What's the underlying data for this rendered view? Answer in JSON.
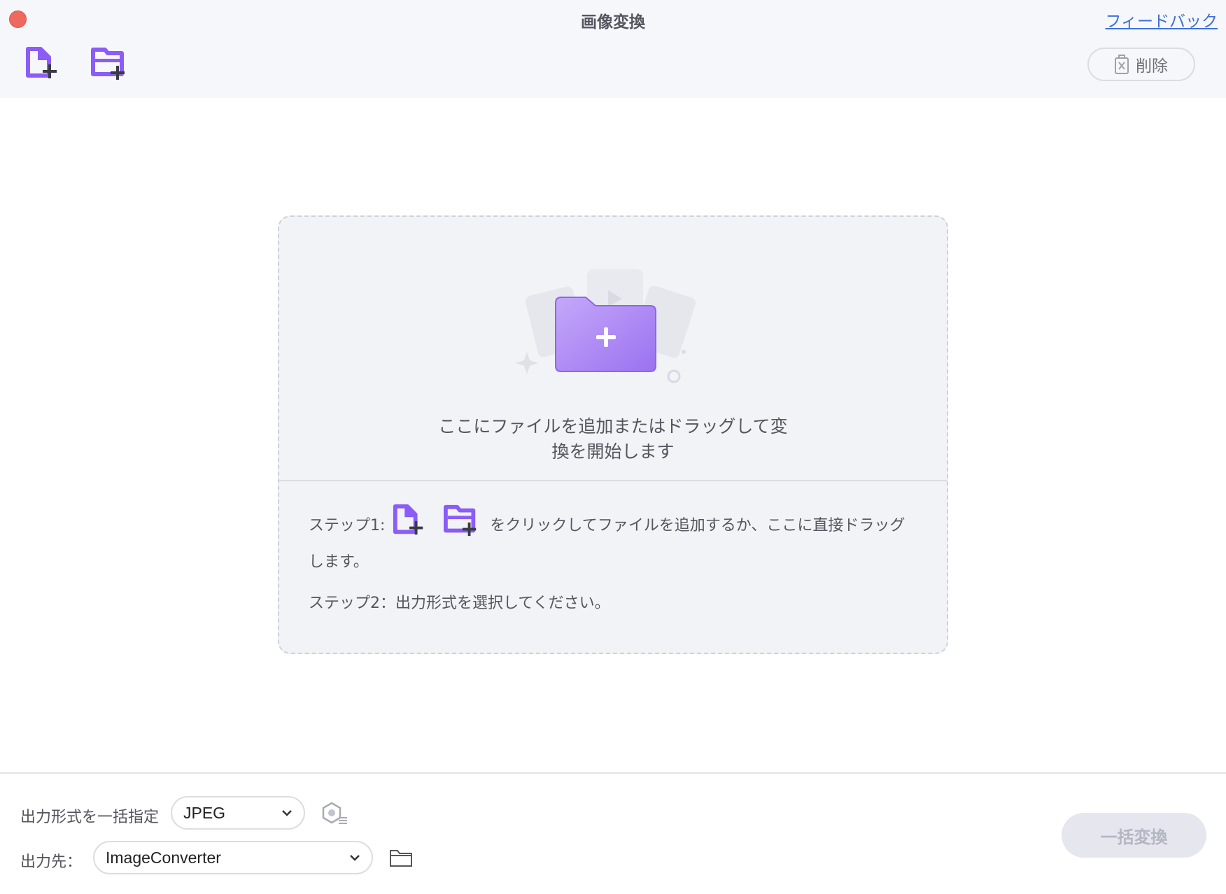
{
  "window": {
    "title": "画像変換",
    "feedback_label": "フィードバック"
  },
  "toolbar": {
    "add_file_icon": "add-file-icon",
    "add_folder_icon": "add-folder-icon",
    "delete_label": "削除"
  },
  "dropzone": {
    "message_line1": "ここにファイルを追加またはドラッグして変",
    "message_line2": "換を開始します",
    "step1_prefix": "ステップ1:",
    "step1_suffix": "をクリックしてファイルを追加するか、ここに直接ドラッグ",
    "step1_line2": "します。",
    "step2_text": "ステップ2：出力形式を選択してください。"
  },
  "footer": {
    "format_label": "出力形式を一括指定",
    "format_value": "JPEG",
    "destination_label": "出力先：",
    "destination_value": "ImageConverter",
    "convert_label": "一括変換"
  },
  "colors": {
    "accent": "#8b5cf6",
    "close": "#ee6a5f",
    "link": "#3f6fd8"
  }
}
